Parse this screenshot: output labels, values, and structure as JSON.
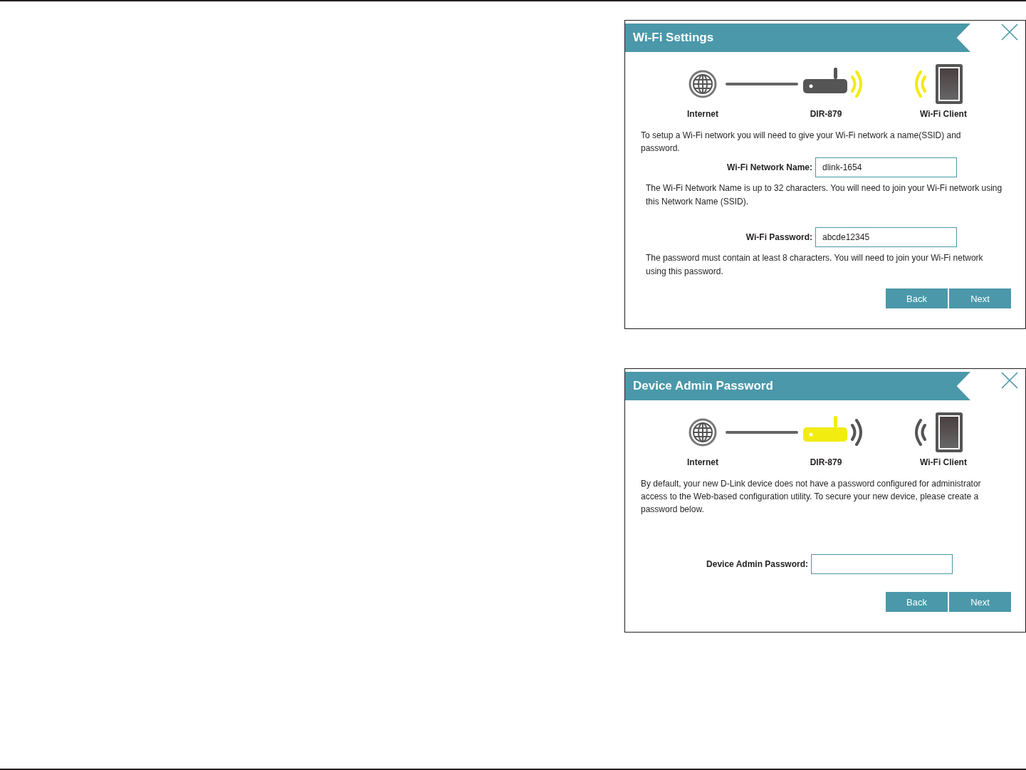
{
  "dialogs": [
    {
      "title": "Wi-Fi Settings",
      "diagram": {
        "router_highlighted": false,
        "signal_highlighted": true,
        "labels": [
          "Internet",
          "DIR-879",
          "Wi-Fi Client"
        ]
      },
      "intro": "To setup a Wi-Fi network you will need to give your Wi-Fi network a name(SSID) and password.",
      "fields": [
        {
          "label": "Wi-Fi Network Name:",
          "value": "dlink-1654",
          "help": "The Wi-Fi Network Name is up to 32 characters. You will need to join your Wi-Fi network using this Network Name (SSID)."
        },
        {
          "label": "Wi-Fi Password:",
          "value": "abcde12345",
          "help": "The password must contain at least 8 characters. You will need to join your Wi-Fi network using this password."
        }
      ],
      "buttons": [
        "Back",
        "Next"
      ]
    },
    {
      "title": "Device Admin Password",
      "diagram": {
        "router_highlighted": true,
        "signal_highlighted": false,
        "labels": [
          "Internet",
          "DIR-879",
          "Wi-Fi Client"
        ]
      },
      "intro": "By default, your new D-Link device does not have a password configured for administrator access to the Web-based configuration utility. To secure your new device, please create a password below.",
      "fields": [
        {
          "label": "Device Admin Password:"
        }
      ],
      "buttons": [
        "Back",
        "Next"
      ]
    }
  ]
}
